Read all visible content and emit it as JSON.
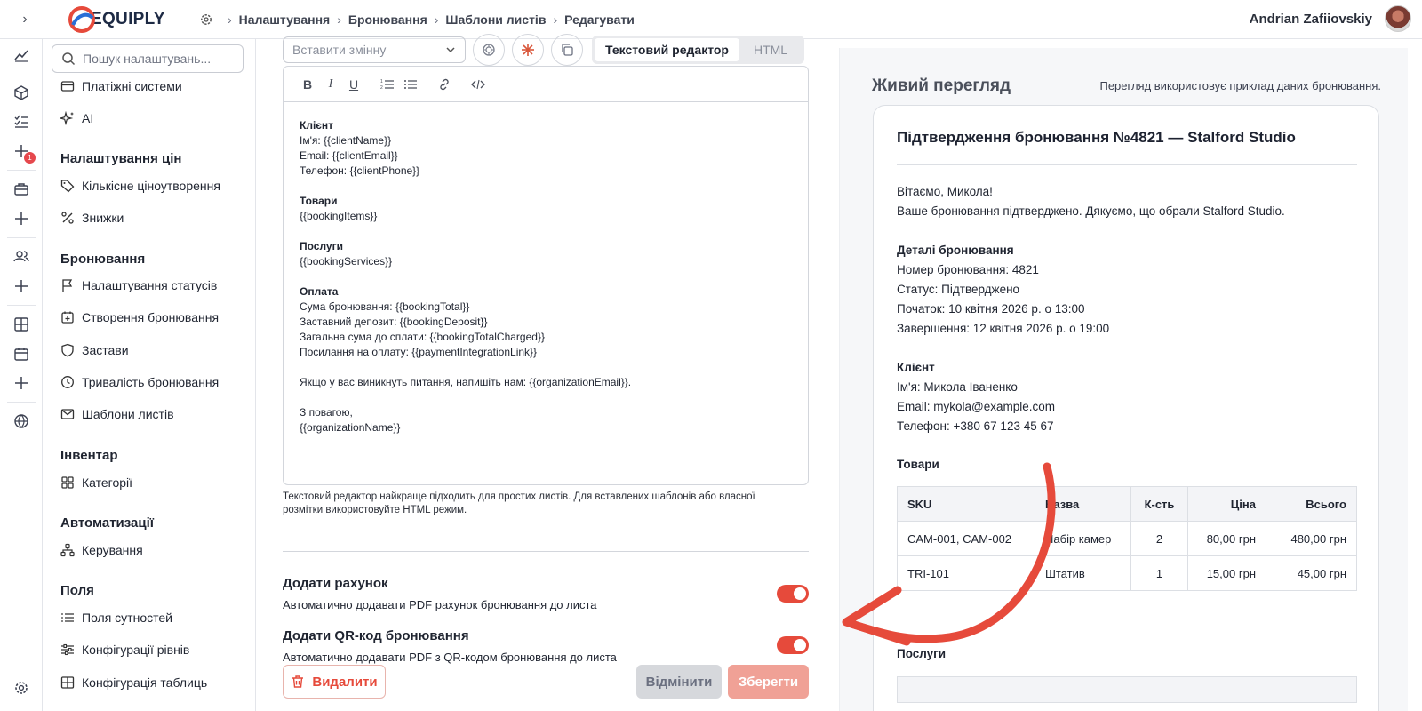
{
  "topbar": {
    "brand": "EQUIPLY",
    "breadcrumb": [
      "Налаштування",
      "Бронювання",
      "Шаблони листів",
      "Редагувати"
    ],
    "user_name": "Andrian Zafiiovskiy"
  },
  "rail": {
    "notification_count": "1",
    "icons": [
      "chart-icon",
      "cube-icon",
      "tasks-icon",
      "plus-icon",
      "briefcase-icon",
      "plus-icon",
      "users-icon",
      "plus-icon",
      "table-icon",
      "calendar-icon",
      "plus-icon",
      "globe-icon",
      "settings-icon"
    ]
  },
  "sidebar": {
    "search_placeholder": "Пошук налаштувань...",
    "items_top": [
      {
        "label": "Платіжні системи",
        "icon": "card-icon"
      },
      {
        "label": "AI",
        "icon": "sparkle-icon"
      }
    ],
    "groups": [
      {
        "title": "Налаштування цін",
        "items": [
          {
            "label": "Кількісне ціноутворення",
            "icon": "tag-icon"
          },
          {
            "label": "Знижки",
            "icon": "percent-icon"
          }
        ]
      },
      {
        "title": "Бронювання",
        "items": [
          {
            "label": "Налаштування статусів",
            "icon": "flag-icon"
          },
          {
            "label": "Створення бронювання",
            "icon": "calendar-plus-icon"
          },
          {
            "label": "Застави",
            "icon": "shield-icon"
          },
          {
            "label": "Тривалість бронювання",
            "icon": "clock-icon"
          },
          {
            "label": "Шаблони листів",
            "icon": "mail-icon"
          }
        ]
      },
      {
        "title": "Інвентар",
        "items": [
          {
            "label": "Категорії",
            "icon": "grid-icon"
          }
        ]
      },
      {
        "title": "Автоматизації",
        "items": [
          {
            "label": "Керування",
            "icon": "workflow-icon"
          }
        ]
      },
      {
        "title": "Поля",
        "items": [
          {
            "label": "Поля сутностей",
            "icon": "list-icon"
          },
          {
            "label": "Конфігурації рівнів",
            "icon": "sliders-icon"
          },
          {
            "label": "Конфігурація таблиць",
            "icon": "table-icon"
          }
        ]
      }
    ]
  },
  "editor": {
    "variable_placeholder": "Вставити змінну",
    "mode_text": "Текстовий редактор",
    "mode_html": "HTML",
    "body": [
      {
        "heading": "Клієнт",
        "lines": [
          "Ім'я: {{clientName}}",
          "Email: {{clientEmail}}",
          "Телефон: {{clientPhone}}"
        ]
      },
      {
        "heading": "Товари",
        "lines": [
          "{{bookingItems}}"
        ]
      },
      {
        "heading": "Послуги",
        "lines": [
          "{{bookingServices}}"
        ]
      },
      {
        "heading": "Оплата",
        "lines": [
          "Сума бронювання: {{bookingTotal}}",
          "Заставний депозит: {{bookingDeposit}}",
          "Загальна сума до сплати: {{bookingTotalCharged}}",
          "Посилання на оплату: {{paymentIntegrationLink}}"
        ]
      },
      {
        "heading": "",
        "lines": [
          "Якщо у вас виникнуть питання, напишіть нам: {{organizationEmail}}."
        ]
      },
      {
        "heading": "",
        "lines": [
          "З повагою,",
          "{{organizationName}}"
        ]
      }
    ],
    "hint": "Текстовий редактор найкраще підходить для простих листів. Для вставлених шаблонів або власної розмітки використовуйте HTML режим."
  },
  "options": {
    "invoice_title": "Додати рахунок",
    "invoice_desc": "Автоматично додавати PDF рахунок бронювання до листа",
    "invoice_on": true,
    "qr_title": "Додати QR-код бронювання",
    "qr_desc": "Автоматично додавати PDF з QR-кодом бронювання до листа",
    "qr_on": true
  },
  "actions": {
    "delete": "Видалити",
    "cancel": "Відмінити",
    "save": "Зберегти"
  },
  "preview": {
    "title": "Живий перегляд",
    "note": "Перегляд використовує приклад даних бронювання.",
    "subject": "Підтвердження бронювання №4821 — Stalford Studio",
    "greeting": "Вітаємо, Микола!",
    "intro": "Ваше бронювання підтверджено. Дякуємо, що обрали Stalford Studio.",
    "details_heading": "Деталі бронювання",
    "details": [
      "Номер бронювання: 4821",
      "Статус: Підтверджено",
      "Початок: 10 квітня 2026 р. о 13:00",
      "Завершення: 12 квітня 2026 р. о 19:00"
    ],
    "client_heading": "Клієнт",
    "client": [
      "Ім'я: Микола Іваненко",
      "Email: mykola@example.com",
      "Телефон: +380 67 123 45 67"
    ],
    "items_heading": "Товари",
    "items_columns": [
      "SKU",
      "Назва",
      "К-сть",
      "Ціна",
      "Всього"
    ],
    "items_rows": [
      [
        "CAM-001, CAM-002",
        "Набір камер",
        "2",
        "80,00 грн",
        "480,00 грн"
      ],
      [
        "TRI-101",
        "Штатив",
        "1",
        "15,00 грн",
        "45,00 грн"
      ]
    ],
    "services_heading": "Послуги"
  },
  "colors": {
    "accent": "#e64a3b",
    "brand": "#1d2a44"
  }
}
